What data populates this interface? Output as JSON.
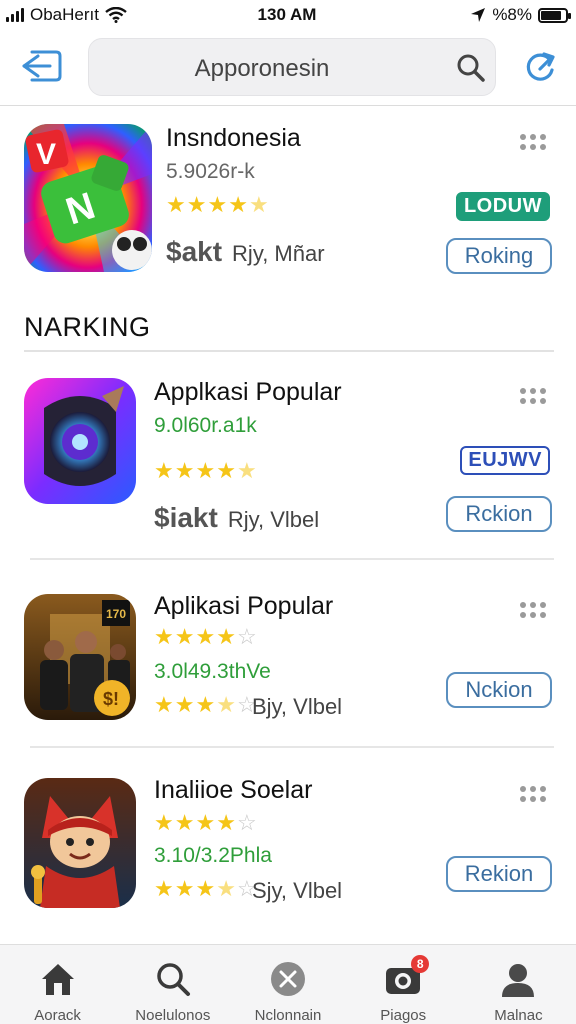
{
  "status_bar": {
    "carrier": "ObaHerıt",
    "time": "130 AM",
    "battery_text": "%8%",
    "battery_level": 0.85
  },
  "header": {
    "back_icon": "back-arrow-icon",
    "search_text": "Apporonesin",
    "search_icon": "search-icon",
    "refresh_icon": "refresh-icon"
  },
  "featured": {
    "title": "Insndonesia",
    "subtitle": "5.9026r-k",
    "rating": 4.5,
    "price": "$akt",
    "meta": "Rjy, Mñar",
    "badge": "LODUW",
    "button": "Roking",
    "colors": {
      "badge": "#1e9e7a"
    }
  },
  "section": {
    "title": "NARKING"
  },
  "apps": [
    {
      "title": "Applkasi Popular",
      "subtitle": "9.0l60r.a1k",
      "rating": 4.5,
      "price": "$iakt",
      "meta": "Rjy, Vlbel",
      "badge": "EUJWV",
      "button": "Rckion",
      "icon": "speaker-app-icon"
    },
    {
      "title": "Aplikasi Popular",
      "subtitle": "3.0l49.3thVe",
      "rating": 4.0,
      "rating2": 3.5,
      "meta": "Bjy, Vlbel",
      "button": "Nckion",
      "icon": "movie-app-icon"
    },
    {
      "title": "Inaliioe Soelar",
      "subtitle": "3.10/3.2Phla",
      "rating": 4.0,
      "rating2": 3.5,
      "meta": "Sjy, Vlbel",
      "button": "Rekion",
      "icon": "hero-game-icon"
    }
  ],
  "tabs": [
    {
      "label": "Aorack",
      "icon": "home-icon"
    },
    {
      "label": "Noelulonos",
      "icon": "search-icon"
    },
    {
      "label": "Nclonnain",
      "icon": "close-circle-icon"
    },
    {
      "label": "Piagos",
      "icon": "camera-icon",
      "badge": "8"
    },
    {
      "label": "Malnac",
      "icon": "person-icon"
    }
  ]
}
